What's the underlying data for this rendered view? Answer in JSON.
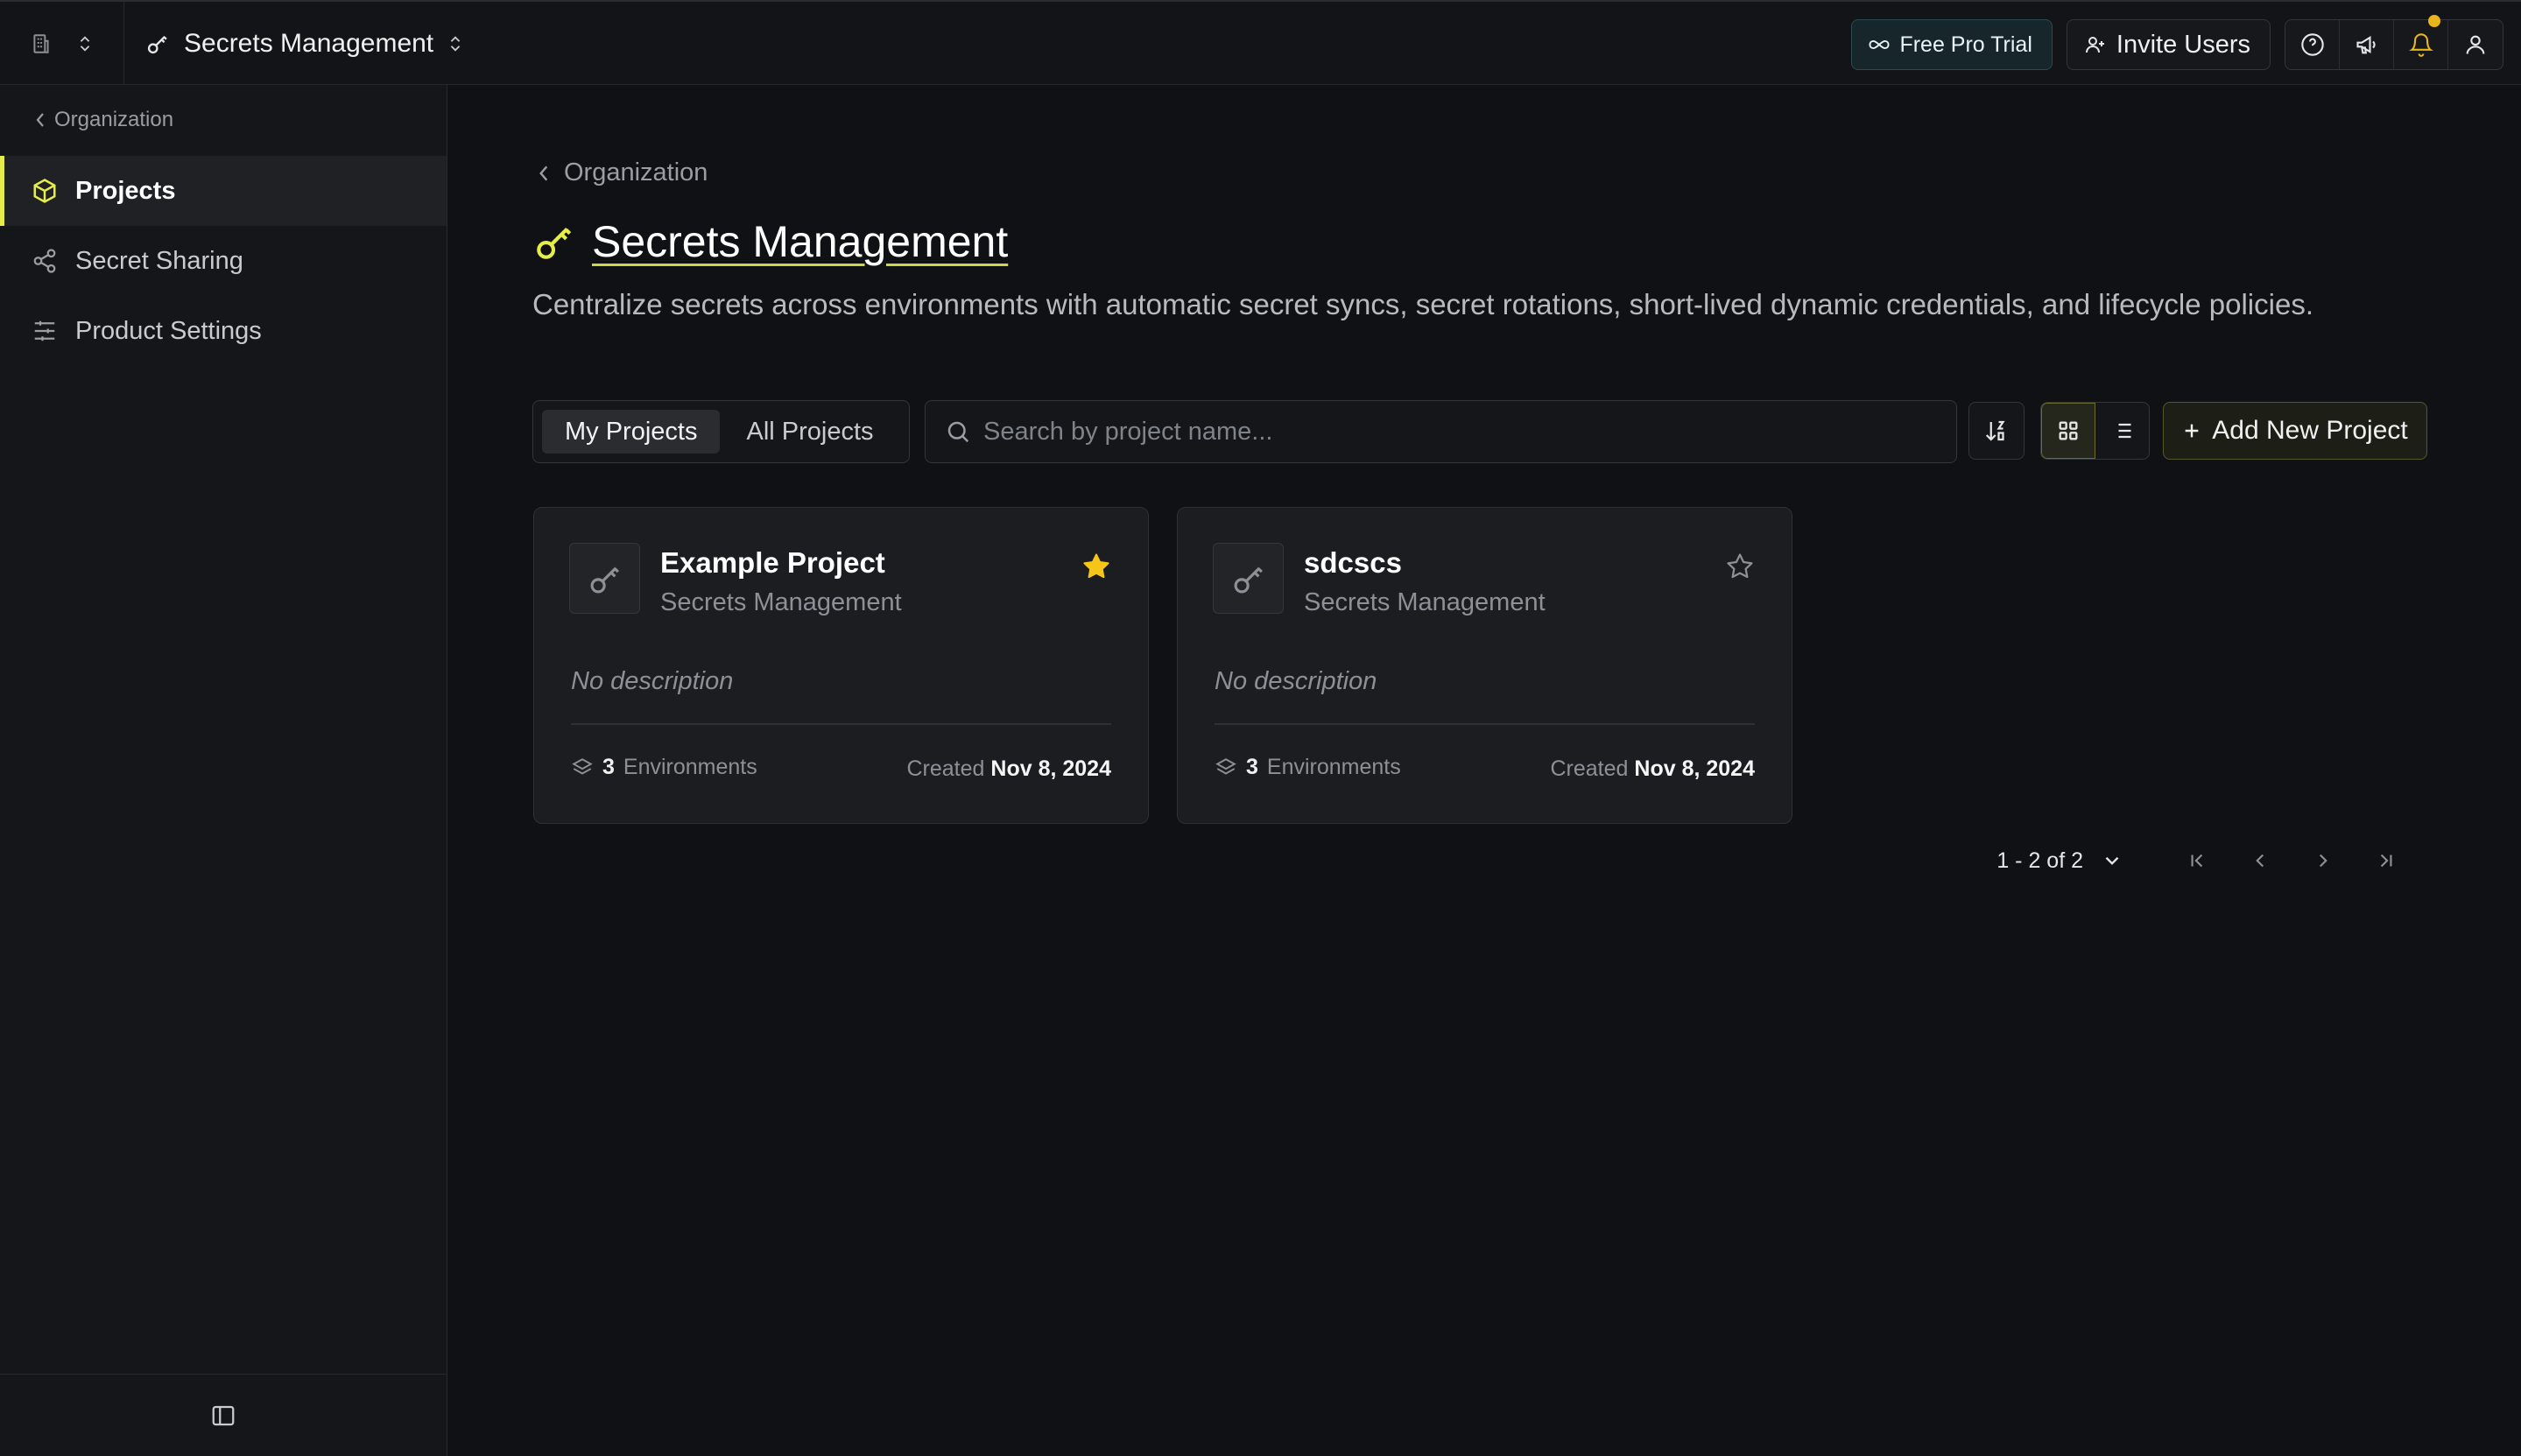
{
  "topbar": {
    "product_name": "Secrets Management",
    "free_trial_label": "Free Pro Trial",
    "invite_label": "Invite Users"
  },
  "sidebar": {
    "back_label": "Organization",
    "items": [
      {
        "label": "Projects",
        "icon": "cube-icon",
        "active": true
      },
      {
        "label": "Secret Sharing",
        "icon": "share-icon",
        "active": false
      },
      {
        "label": "Product Settings",
        "icon": "sliders-icon",
        "active": false
      }
    ]
  },
  "main": {
    "breadcrumb": "Organization",
    "title": "Secrets Management",
    "description": "Centralize secrets across environments with automatic secret syncs, secret rotations, short-lived dynamic credentials, and lifecycle policies.",
    "tabs": [
      {
        "label": "My Projects",
        "active": true
      },
      {
        "label": "All Projects",
        "active": false
      }
    ],
    "search_placeholder": "Search by project name...",
    "view_mode": "grid",
    "add_button_label": "Add New Project"
  },
  "projects": [
    {
      "name": "Example Project",
      "type": "Secrets Management",
      "description": "No description",
      "environments_count": "3",
      "environments_label": "Environments",
      "created_label": "Created",
      "created_date": "Nov 8, 2024",
      "favorite": true
    },
    {
      "name": "sdcscs",
      "type": "Secrets Management",
      "description": "No description",
      "environments_count": "3",
      "environments_label": "Environments",
      "created_label": "Created",
      "created_date": "Nov 8, 2024",
      "favorite": false
    }
  ],
  "pagination": {
    "range_label": "1 - 2 of 2"
  },
  "colors": {
    "accent": "#e6ed4a",
    "star": "#f5c518",
    "notification_dot": "#e8b51d",
    "background": "#0f1114"
  }
}
